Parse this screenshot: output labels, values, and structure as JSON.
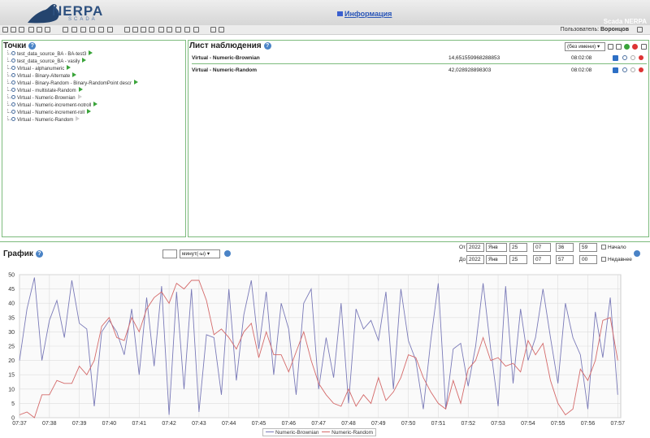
{
  "header": {
    "logo_text": "NERPA",
    "logo_sub": "SCADA",
    "info_link": "Информация",
    "scada_title": "Scada NERPA",
    "user_label": "Пользователь:",
    "user_name": "Воронцов"
  },
  "points": {
    "title": "Точки",
    "items": [
      {
        "label": "test_data_source_BA - BA-test3",
        "arrow": "green"
      },
      {
        "label": "test_data_source_BA - vasily",
        "arrow": "green"
      },
      {
        "label": "Virtual - alphanumeric",
        "arrow": "green"
      },
      {
        "label": "Virtual - Binary-Alternate",
        "arrow": "green"
      },
      {
        "label": "Virtual - Binary-Random - Binary-RandomPoint descr",
        "arrow": "green"
      },
      {
        "label": "Virtual - multistate-Random",
        "arrow": "green"
      },
      {
        "label": "Virtual - Numeric-Brownian",
        "arrow": "gray"
      },
      {
        "label": "Virtual - Numeric-increment-notroll",
        "arrow": "green"
      },
      {
        "label": "Virtual - Numeric-increment-roll",
        "arrow": "green"
      },
      {
        "label": "Virtual - Numeric-Random",
        "arrow": "gray"
      }
    ]
  },
  "watchlist": {
    "title": "Лист наблюдения",
    "selected_list": "(без имени)",
    "rows": [
      {
        "name": "Virtual - Numeric-Brownian",
        "value": "14,651559968288853",
        "time": "08:02:08"
      },
      {
        "name": "Virtual - Numeric-Random",
        "value": "42,028928898303",
        "time": "08:02:08"
      }
    ]
  },
  "graph": {
    "title": "График",
    "period_value": "",
    "period_unit": "минут(-ы)",
    "from_label": "От",
    "to_label": "До",
    "from": {
      "year": "2022",
      "month": "Янв",
      "day": "25",
      "hour": "07",
      "minute": "36",
      "second": "59"
    },
    "to": {
      "year": "2022",
      "month": "Янв",
      "day": "25",
      "hour": "07",
      "minute": "57",
      "second": "00"
    },
    "start_label": "Начало",
    "recent_label": "Недавнее"
  },
  "chart_data": {
    "type": "line",
    "x_ticks": [
      "07:37",
      "07:38",
      "07:39",
      "07:40",
      "07:41",
      "07:42",
      "07:43",
      "07:44",
      "07:45",
      "07:46",
      "07:47",
      "07:48",
      "07:49",
      "07:50",
      "07:51",
      "07:52",
      "07:53",
      "07:54",
      "07:55",
      "07:56",
      "07:57"
    ],
    "y_ticks": [
      0,
      5,
      10,
      15,
      20,
      25,
      30,
      35,
      40,
      45,
      50
    ],
    "ylim": [
      0,
      50
    ],
    "xlim_minutes": [
      0,
      20.1
    ],
    "colors": {
      "Numeric-Brownian": "#7a7ab8",
      "Numeric-Random": "#d46a6a"
    },
    "series": [
      {
        "name": "Numeric-Brownian",
        "x": [
          0,
          0.25,
          0.5,
          0.75,
          1,
          1.25,
          1.5,
          1.75,
          2,
          2.25,
          2.5,
          2.75,
          3,
          3.25,
          3.5,
          3.75,
          4,
          4.25,
          4.5,
          4.75,
          5,
          5.25,
          5.5,
          5.75,
          6,
          6.25,
          6.5,
          6.75,
          7,
          7.25,
          7.5,
          7.75,
          8,
          8.25,
          8.5,
          8.75,
          9,
          9.25,
          9.5,
          9.75,
          10,
          10.25,
          10.5,
          10.75,
          11,
          11.25,
          11.5,
          11.75,
          12,
          12.25,
          12.5,
          12.75,
          13,
          13.25,
          13.5,
          13.75,
          14,
          14.25,
          14.5,
          14.75,
          15,
          15.25,
          15.5,
          15.75,
          16,
          16.25,
          16.5,
          16.75,
          17,
          17.25,
          17.5,
          17.75,
          18,
          18.25,
          18.5,
          18.75,
          19,
          19.25,
          19.5,
          19.75,
          20
        ],
        "values": [
          20,
          38,
          49,
          20,
          34,
          41,
          28,
          48,
          33,
          31,
          4,
          30,
          34,
          30,
          22,
          38,
          15,
          42,
          18,
          46,
          1,
          44,
          10,
          45,
          2,
          29,
          28,
          8,
          45,
          13,
          36,
          48,
          24,
          44,
          15,
          40,
          31,
          8,
          40,
          45,
          10,
          28,
          14,
          40,
          5,
          38,
          31,
          34,
          27,
          44,
          10,
          45,
          27,
          20,
          3,
          27,
          47,
          3,
          24,
          26,
          11,
          25,
          47,
          24,
          4,
          46,
          12,
          38,
          20,
          28,
          45,
          28,
          12,
          40,
          28,
          22,
          3,
          37,
          21,
          42,
          8
        ]
      },
      {
        "name": "Numeric-Random",
        "x": [
          0,
          0.25,
          0.5,
          0.75,
          1,
          1.25,
          1.5,
          1.75,
          2,
          2.25,
          2.5,
          2.75,
          3,
          3.25,
          3.5,
          3.75,
          4,
          4.25,
          4.5,
          4.75,
          5,
          5.25,
          5.5,
          5.75,
          6,
          6.25,
          6.5,
          6.75,
          7,
          7.25,
          7.5,
          7.75,
          8,
          8.25,
          8.5,
          8.75,
          9,
          9.25,
          9.5,
          9.75,
          10,
          10.25,
          10.5,
          10.75,
          11,
          11.25,
          11.5,
          11.75,
          12,
          12.25,
          12.5,
          12.75,
          13,
          13.25,
          13.5,
          13.75,
          14,
          14.25,
          14.5,
          14.75,
          15,
          15.25,
          15.5,
          15.75,
          16,
          16.25,
          16.5,
          16.75,
          17,
          17.25,
          17.5,
          17.75,
          18,
          18.25,
          18.5,
          18.75,
          19,
          19.25,
          19.5,
          19.75,
          20
        ],
        "values": [
          1,
          2,
          0,
          8,
          8,
          13,
          12,
          12,
          18,
          15,
          20,
          32,
          35,
          28,
          27,
          35,
          30,
          38,
          42,
          44,
          40,
          47,
          45,
          48,
          48,
          41,
          29,
          31,
          28,
          24,
          30,
          33,
          21,
          30,
          22,
          22,
          16,
          23,
          30,
          20,
          12,
          8,
          5,
          4,
          10,
          4,
          8,
          5,
          14,
          6,
          9,
          14,
          22,
          21,
          14,
          9,
          5,
          3,
          13,
          5,
          17,
          20,
          28,
          20,
          21,
          18,
          19,
          16,
          27,
          22,
          26,
          13,
          5,
          1,
          3,
          17,
          13,
          20,
          34,
          35,
          20
        ]
      }
    ]
  }
}
